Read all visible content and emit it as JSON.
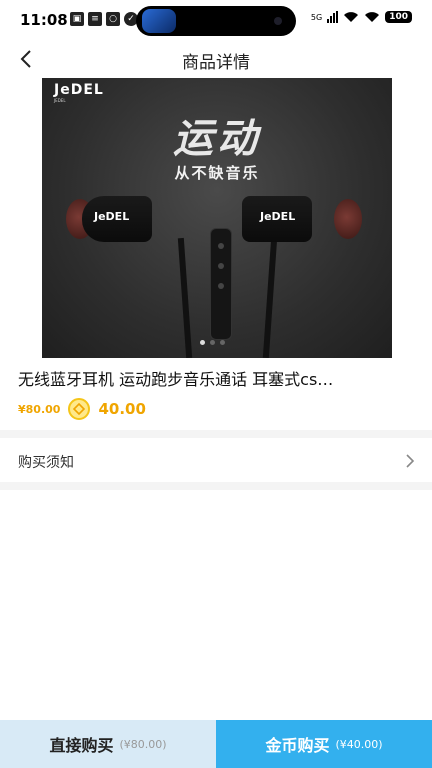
{
  "status_bar": {
    "time": "11:08",
    "notification_icons": [
      "sim-icon",
      "message-icon",
      "app-icon",
      "check-icon"
    ],
    "network": "5G",
    "battery": "100"
  },
  "nav": {
    "back_icon": "chevron-left-icon",
    "title": "商品详情"
  },
  "product": {
    "image": {
      "brand": "JeDEL",
      "brand_tagline": "JEDEL",
      "headline": "运动",
      "subline": "从不缺音乐",
      "bud_label": "JeDEL",
      "slide_count": 3,
      "active_slide": 1
    },
    "title": "无线蓝牙耳机 运动跑步音乐通话 耳塞式cs…",
    "price_original": "¥80.00",
    "coin_icon": "coin-icon",
    "price_coins": "40.00"
  },
  "purchase_notice": {
    "label": "购买须知",
    "chevron_icon": "chevron-right-icon"
  },
  "bottom_bar": {
    "direct_label": "直接购买",
    "direct_price": "(¥80.00)",
    "coin_label": "金币购买",
    "coin_price": "(¥40.00)"
  },
  "colors": {
    "accent": "#33b0ee",
    "accent_light": "#d8eaf6",
    "price": "#f0a500"
  }
}
